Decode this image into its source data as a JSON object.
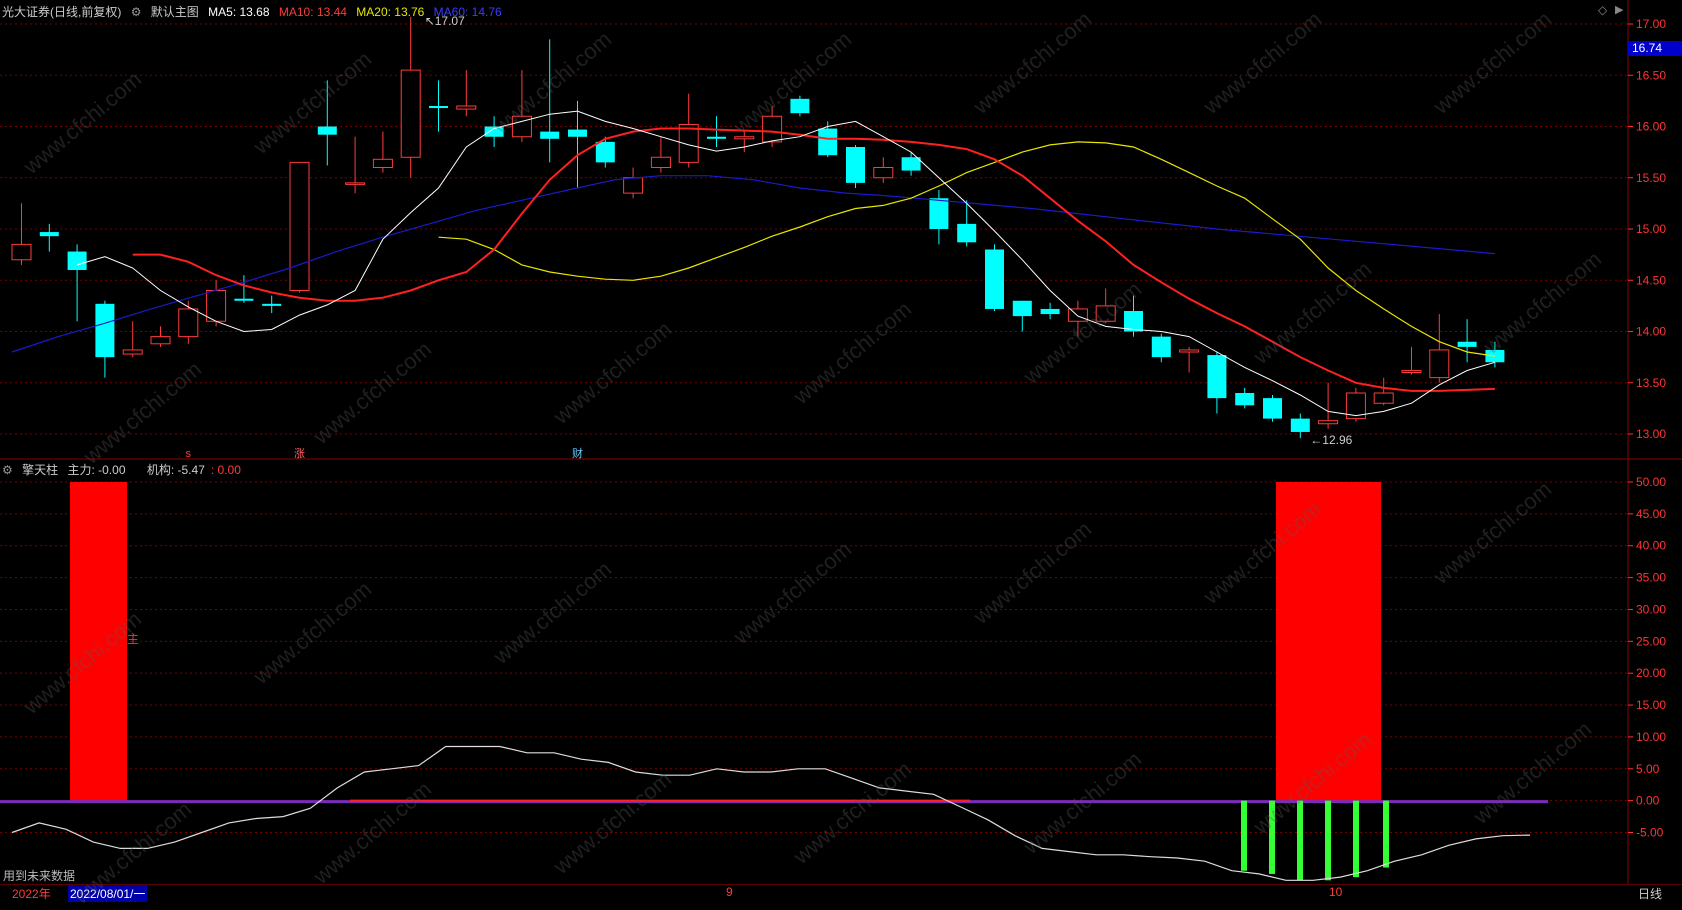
{
  "main_header": {
    "stock_name": "光大证券",
    "period": "(日线,前复权)",
    "template": "默认主图",
    "ma5": "MA5: 13.68",
    "ma10": "MA10: 13.44",
    "ma20": "MA20: 13.76",
    "ma60": "MA60: 14.76"
  },
  "sub_header": {
    "indicator": "擎天柱",
    "main_force": "主力: -0.00",
    "institution": "机构: -5.47",
    "inst_value": ": 0.00"
  },
  "colors": {
    "ma5": "#ffffff",
    "ma10": "#ff2020",
    "ma20": "#e6e600",
    "ma60": "#1a1acc",
    "up": "#ff3b3b",
    "down": "#00ffff",
    "grid": "#7a0000",
    "bars": "#ff0000",
    "green_bars": "#33ff33",
    "purple_line": "#7a2cb8"
  },
  "price_axis": [
    "17.00",
    "16.74",
    "16.50",
    "16.00",
    "15.50",
    "15.00",
    "14.50",
    "14.00",
    "13.50",
    "13.00"
  ],
  "current_price": "16.74",
  "annotations": {
    "high": "17.07",
    "low": "12.96",
    "marker_s": "s",
    "marker_zhang": "涨",
    "marker_cai": "财",
    "side_label": "主"
  },
  "ind_axis": [
    "50.00",
    "45.00",
    "40.00",
    "35.00",
    "30.00",
    "25.00",
    "20.00",
    "15.00",
    "10.00",
    "5.00",
    "0.00",
    "-5.00"
  ],
  "bottom": {
    "future_note": "用到未来数据",
    "year": "2022年",
    "date_range": "2022/08/01/一",
    "month_9": "9",
    "month_10": "10",
    "period_btn": "日线"
  },
  "watermark": "www.cfchi.com",
  "candles": [
    {
      "o": 14.7,
      "c": 14.85,
      "h": 15.25,
      "l": 14.65
    },
    {
      "o": 14.97,
      "c": 14.93,
      "h": 15.05,
      "l": 14.78
    },
    {
      "o": 14.78,
      "c": 14.6,
      "h": 14.85,
      "l": 14.1
    },
    {
      "o": 14.27,
      "c": 13.75,
      "h": 14.3,
      "l": 13.55
    },
    {
      "o": 13.78,
      "c": 13.82,
      "h": 14.1,
      "l": 13.75
    },
    {
      "o": 13.88,
      "c": 13.95,
      "h": 14.05,
      "l": 13.85
    },
    {
      "o": 13.95,
      "c": 14.22,
      "h": 14.3,
      "l": 13.88
    },
    {
      "o": 14.1,
      "c": 14.4,
      "h": 14.5,
      "l": 14.05
    },
    {
      "o": 14.32,
      "c": 14.3,
      "h": 14.55,
      "l": 14.28
    },
    {
      "o": 14.27,
      "c": 14.25,
      "h": 14.35,
      "l": 14.18
    },
    {
      "o": 14.4,
      "c": 15.65,
      "h": 15.65,
      "l": 14.38
    },
    {
      "o": 16.0,
      "c": 15.92,
      "h": 16.45,
      "l": 15.62
    },
    {
      "o": 15.45,
      "c": 15.45,
      "h": 15.9,
      "l": 15.35
    },
    {
      "o": 15.6,
      "c": 15.68,
      "h": 15.95,
      "l": 15.55
    },
    {
      "o": 15.7,
      "c": 16.55,
      "h": 17.07,
      "l": 15.5
    },
    {
      "o": 16.2,
      "c": 16.18,
      "h": 16.45,
      "l": 15.95
    },
    {
      "o": 16.17,
      "c": 16.2,
      "h": 16.55,
      "l": 16.1
    },
    {
      "o": 16.0,
      "c": 15.9,
      "h": 16.1,
      "l": 15.8
    },
    {
      "o": 15.9,
      "c": 16.1,
      "h": 16.55,
      "l": 15.85
    },
    {
      "o": 15.95,
      "c": 15.88,
      "h": 16.85,
      "l": 15.65
    },
    {
      "o": 15.97,
      "c": 15.9,
      "h": 16.25,
      "l": 15.4
    },
    {
      "o": 15.85,
      "c": 15.65,
      "h": 15.9,
      "l": 15.6
    },
    {
      "o": 15.35,
      "c": 15.5,
      "h": 15.6,
      "l": 15.3
    },
    {
      "o": 15.6,
      "c": 15.7,
      "h": 15.9,
      "l": 15.55
    },
    {
      "o": 15.65,
      "c": 16.02,
      "h": 16.32,
      "l": 15.6
    },
    {
      "o": 15.9,
      "c": 15.88,
      "h": 16.1,
      "l": 15.8
    },
    {
      "o": 15.88,
      "c": 15.9,
      "h": 15.95,
      "l": 15.75
    },
    {
      "o": 15.85,
      "c": 16.1,
      "h": 16.2,
      "l": 15.8
    },
    {
      "o": 16.27,
      "c": 16.13,
      "h": 16.3,
      "l": 16.1
    },
    {
      "o": 15.98,
      "c": 15.72,
      "h": 16.05,
      "l": 15.7
    },
    {
      "o": 15.8,
      "c": 15.45,
      "h": 15.82,
      "l": 15.4
    },
    {
      "o": 15.5,
      "c": 15.6,
      "h": 15.7,
      "l": 15.45
    },
    {
      "o": 15.7,
      "c": 15.57,
      "h": 15.75,
      "l": 15.52
    },
    {
      "o": 15.3,
      "c": 15.0,
      "h": 15.38,
      "l": 14.85
    },
    {
      "o": 15.05,
      "c": 14.87,
      "h": 15.28,
      "l": 14.83
    },
    {
      "o": 14.8,
      "c": 14.22,
      "h": 14.85,
      "l": 14.2
    },
    {
      "o": 14.3,
      "c": 14.15,
      "h": 14.3,
      "l": 14.0
    },
    {
      "o": 14.22,
      "c": 14.17,
      "h": 14.28,
      "l": 14.12
    },
    {
      "o": 14.1,
      "c": 14.22,
      "h": 14.3,
      "l": 13.95
    },
    {
      "o": 14.1,
      "c": 14.25,
      "h": 14.42,
      "l": 14.08
    },
    {
      "o": 14.2,
      "c": 14.0,
      "h": 14.35,
      "l": 13.95
    },
    {
      "o": 13.95,
      "c": 13.75,
      "h": 13.98,
      "l": 13.7
    },
    {
      "o": 13.8,
      "c": 13.82,
      "h": 13.85,
      "l": 13.6
    },
    {
      "o": 13.77,
      "c": 13.35,
      "h": 13.8,
      "l": 13.2
    },
    {
      "o": 13.4,
      "c": 13.28,
      "h": 13.45,
      "l": 13.25
    },
    {
      "o": 13.35,
      "c": 13.15,
      "h": 13.38,
      "l": 13.12
    },
    {
      "o": 13.15,
      "c": 13.02,
      "h": 13.2,
      "l": 12.96
    },
    {
      "o": 13.1,
      "c": 13.13,
      "h": 13.5,
      "l": 13.05
    },
    {
      "o": 13.15,
      "c": 13.4,
      "h": 13.45,
      "l": 13.12
    },
    {
      "o": 13.3,
      "c": 13.4,
      "h": 13.55,
      "l": 13.28
    },
    {
      "o": 13.6,
      "c": 13.62,
      "h": 13.85,
      "l": 13.58
    },
    {
      "o": 13.55,
      "c": 13.82,
      "h": 14.17,
      "l": 13.5
    },
    {
      "o": 13.9,
      "c": 13.85,
      "h": 14.12,
      "l": 13.7
    },
    {
      "o": 13.82,
      "c": 13.7,
      "h": 13.9,
      "l": 13.65
    }
  ],
  "ma5": [
    14.65,
    14.73,
    14.62,
    14.4,
    14.24,
    14.1,
    14.0,
    14.02,
    14.16,
    14.26,
    14.4,
    14.9,
    15.16,
    15.4,
    15.8,
    15.98,
    16.05,
    16.12,
    16.15,
    16.05,
    15.98,
    15.9,
    15.82,
    15.76,
    15.8,
    15.86,
    15.9,
    16.0,
    16.05,
    15.9,
    15.75,
    15.5,
    15.25,
    14.98,
    14.7,
    14.4,
    14.15,
    14.05,
    14.02,
    14.0,
    13.95,
    13.8,
    13.65,
    13.52,
    13.38,
    13.22,
    13.18,
    13.22,
    13.3,
    13.48,
    13.62,
    13.7
  ],
  "ma10": [
    14.75,
    14.75,
    14.68,
    14.55,
    14.45,
    14.38,
    14.33,
    14.3,
    14.3,
    14.33,
    14.4,
    14.5,
    14.58,
    14.8,
    15.15,
    15.48,
    15.72,
    15.88,
    15.95,
    15.98,
    15.98,
    15.97,
    15.96,
    15.95,
    15.92,
    15.88,
    15.88,
    15.87,
    15.85,
    15.82,
    15.78,
    15.68,
    15.52,
    15.3,
    15.08,
    14.88,
    14.65,
    14.48,
    14.32,
    14.18,
    14.05,
    13.9,
    13.75,
    13.62,
    13.5,
    13.45,
    13.42,
    13.42,
    13.43,
    13.44
  ],
  "ma20": [
    14.92,
    14.9,
    14.8,
    14.65,
    14.58,
    14.54,
    14.51,
    14.5,
    14.54,
    14.62,
    14.72,
    14.82,
    14.93,
    15.02,
    15.12,
    15.2,
    15.23,
    15.3,
    15.42,
    15.55,
    15.65,
    15.75,
    15.82,
    15.85,
    15.84,
    15.8,
    15.68,
    15.55,
    15.42,
    15.3,
    15.1,
    14.9,
    14.62,
    14.4,
    14.22,
    14.05,
    13.9,
    13.8,
    13.76
  ],
  "ma60": [
    13.8,
    13.95,
    14.08,
    14.22,
    14.35,
    14.48,
    14.62,
    14.78,
    14.92,
    15.05,
    15.18,
    15.28,
    15.38,
    15.48,
    15.52,
    15.52,
    15.48,
    15.4,
    15.35,
    15.32,
    15.28,
    15.24,
    15.2,
    15.15,
    15.1,
    15.05,
    15.0,
    14.96,
    14.92,
    14.88,
    14.84,
    14.8,
    14.76
  ],
  "ind_line": [
    -5.0,
    -3.5,
    -4.5,
    -6.5,
    -7.5,
    -7.5,
    -6.5,
    -5.0,
    -3.5,
    -2.8,
    -2.5,
    -1.2,
    2.0,
    4.5,
    5.0,
    5.5,
    8.5,
    8.5,
    8.5,
    7.5,
    7.5,
    6.5,
    6.0,
    4.5,
    4.0,
    4.0,
    5.0,
    4.5,
    4.5,
    5.0,
    5.0,
    3.5,
    2.0,
    1.5,
    1.0,
    -1.0,
    -3.0,
    -5.5,
    -7.5,
    -8.0,
    -8.5,
    -8.5,
    -8.8,
    -9.0,
    -9.5,
    -11.0,
    -11.5,
    -12.5,
    -12.5,
    -12.0,
    -11.0,
    -9.5,
    -8.5,
    -7.0,
    -6.0,
    -5.5,
    -5.4
  ]
}
